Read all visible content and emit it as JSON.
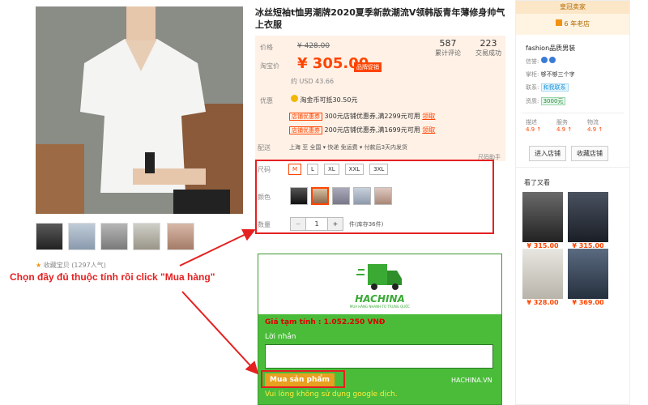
{
  "product": {
    "title": "冰丝短袖t恤男潮牌2020夏季新款潮流V领韩版青年薄修身帅气上衣服",
    "price_label": "价格",
    "original_price": "¥ 428.00",
    "taobao_price_label": "淘宝价",
    "current_price": "¥ 305.00",
    "price_badge": "品牌促销",
    "usd_price": "约 USD 43.66",
    "review_count": "587",
    "review_label": "累计评论",
    "sold_count": "223",
    "sold_label": "交易成功",
    "promo_label": "优惠",
    "promo_main": "淘金币可抵30.50元",
    "coupons": [
      {
        "tag": "店铺优惠券",
        "text": "300元店铺优惠券,满2299元可用",
        "link": "领取"
      },
      {
        "tag": "店铺优惠券",
        "text": "200元店铺优惠券,满1699元可用",
        "link": "领取"
      }
    ],
    "shipping_label": "配送",
    "shipping_text": "上海 至 全国 ▾   快递 免运费 ▾   付款后3天内发货",
    "sizes_label": "尺码",
    "sizes": [
      "M",
      "L",
      "XL",
      "XXL",
      "3XL"
    ],
    "selected_size": "M",
    "color_label": "颜色",
    "qty_label": "数量",
    "qty_value": "1",
    "qty_minus": "−",
    "qty_plus": "+",
    "stock_text": "件(库存36件)",
    "favorite_text": "收藏宝贝 (1297人气)"
  },
  "annotation": {
    "instruction": "Chọn đầy đủ thuộc tính rồi click \"Mua hàng\"",
    "color": "#e52020"
  },
  "hachina": {
    "logo_text": "HACHINA",
    "logo_sub": "MUA HÀNG NHANH TỪ TRUNG QUỐC",
    "estimate": "Giá tạm tính : 1.052.250 VNĐ",
    "message_label": "Lời nhắn",
    "message_value": "",
    "buy_button": "Mua sản phẩm",
    "brand": "HACHINA.VN",
    "warning": "Vui lòng không sử dụng google dịch.",
    "accent": "#4bbc3a"
  },
  "seller": {
    "rank_badge": "皇冠卖家",
    "years": "6 年老店",
    "shop_name": "fashion品质男装",
    "credit_label": "信誉:",
    "boss_label": "掌柜:",
    "boss_value": "够不够三个字",
    "contact_label": "联系:",
    "contact_value": "和我联系",
    "deposit_label": "资质:",
    "deposit_value": "3000元",
    "ratings": [
      {
        "label": "描述",
        "value": "4.9 ↑"
      },
      {
        "label": "服务",
        "value": "4.9 ↑"
      },
      {
        "label": "物流",
        "value": "4.9 ↑"
      }
    ],
    "enter_shop": "进入店铺",
    "favorite_shop": "收藏店铺",
    "also_viewed_title": "看了又看",
    "also_viewed": [
      {
        "price": "¥ 315.00"
      },
      {
        "price": "¥ 315.00"
      },
      {
        "price": "¥ 328.00"
      },
      {
        "price": "¥ 369.00"
      }
    ],
    "hint_link": "尺码助手"
  }
}
